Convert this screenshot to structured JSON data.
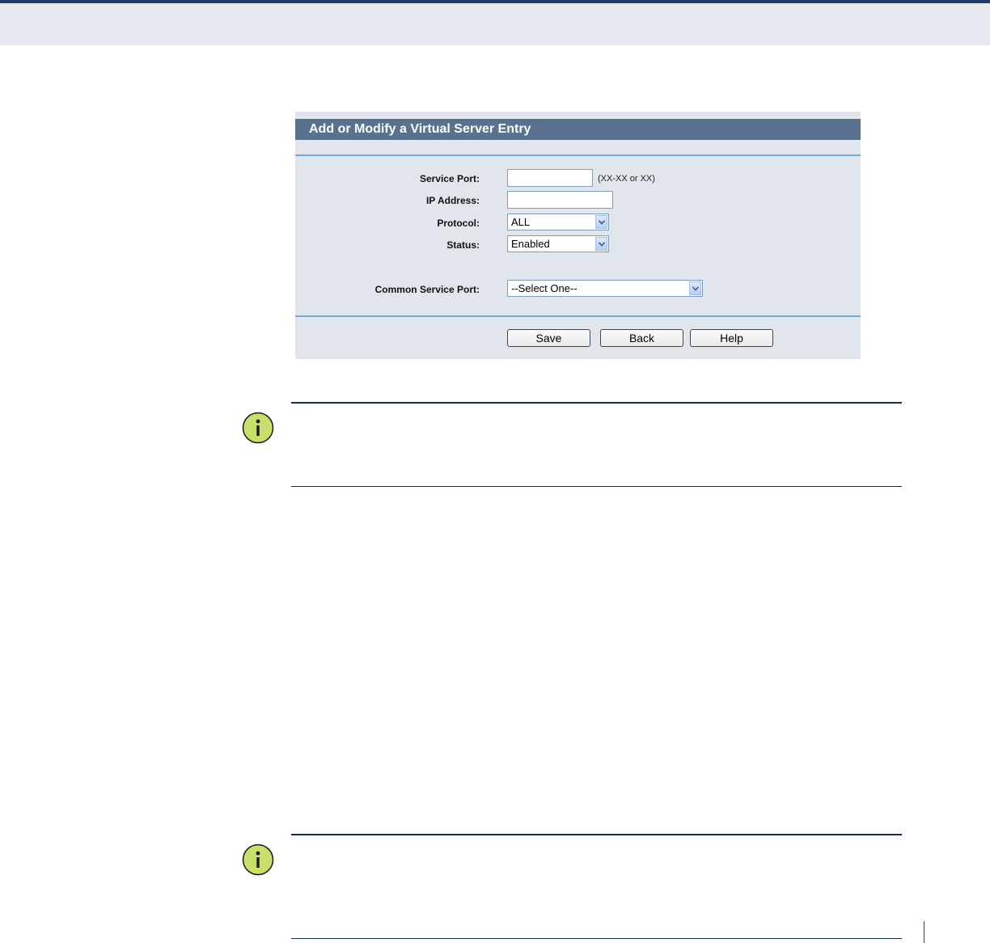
{
  "form": {
    "title": "Add or Modify a Virtual Server Entry",
    "fields": {
      "service_port": {
        "label": "Service Port:",
        "value": "",
        "hint": "(XX-XX or XX)"
      },
      "ip_address": {
        "label": "IP Address:",
        "value": ""
      },
      "protocol": {
        "label": "Protocol:",
        "value": "ALL"
      },
      "status": {
        "label": "Status:",
        "value": "Enabled"
      },
      "common_service_port": {
        "label": "Common Service Port:",
        "value": "--Select One--"
      }
    },
    "buttons": {
      "save": "Save",
      "back": "Back",
      "help": "Help"
    }
  },
  "notes": [
    {
      "icon": "info-icon"
    },
    {
      "icon": "info-icon"
    }
  ],
  "colors": {
    "header_bg": "#597290",
    "panel_bg": "#e1e5ec",
    "divider": "#6fa7d6",
    "note_icon": "#c7e06a",
    "rule": "#1a2a55"
  }
}
